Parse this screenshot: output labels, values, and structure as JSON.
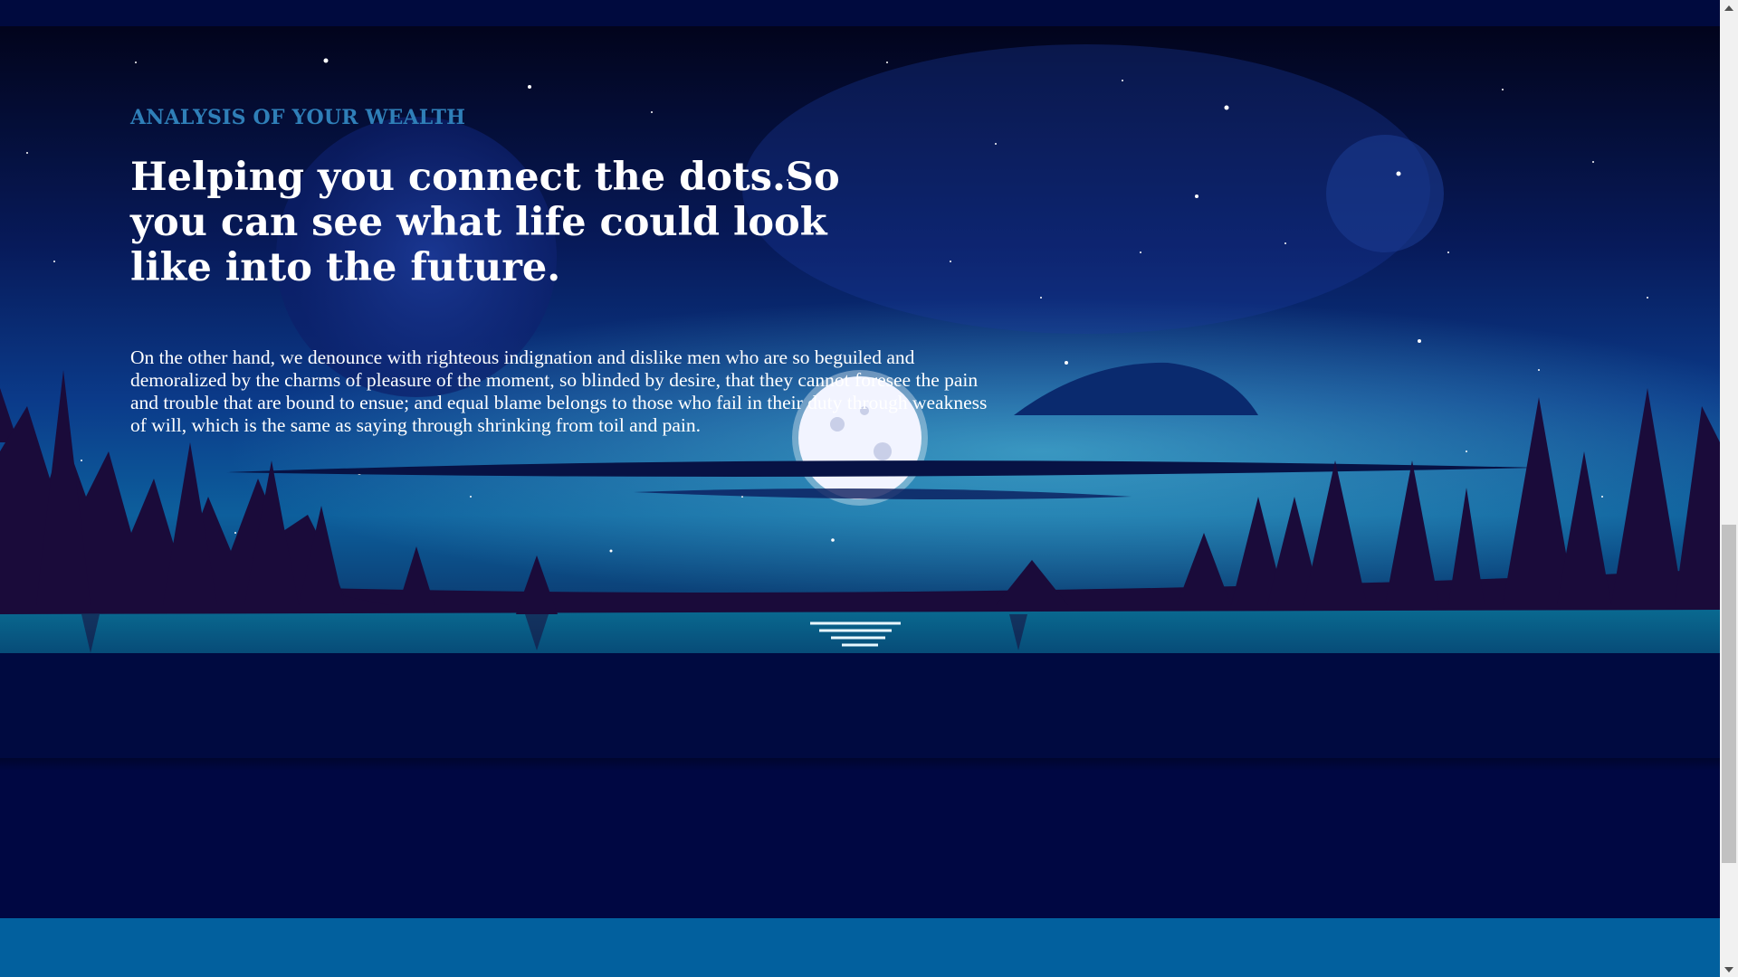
{
  "hero": {
    "eyebrow": "ANALYSIS OF YOUR WEALTH",
    "headline": "Helping you connect the dots.So you can see what life could look like into the future.",
    "body": "On the other hand, we denounce with righteous indignation and dislike men who are so beguiled and demoralized by the charms of pleasure of the moment, so blinded by desire, that they cannot foresee the pain and trouble that are bound to ensue; and equal blame belongs to those who fail in their duty through weakness of will, which is the same as saying through shrinking from toil and pain.",
    "illustration": "night-sky-moon-lake-forest"
  },
  "colors": {
    "eyebrow": "#2f7fb8",
    "text": "#ffffff",
    "page_background": "#000742",
    "footer": "#02609e"
  },
  "icons": {
    "scroll_up": "triangle-up",
    "scroll_down": "triangle-down"
  },
  "scrollbar": {
    "position_fraction": 0.75
  }
}
